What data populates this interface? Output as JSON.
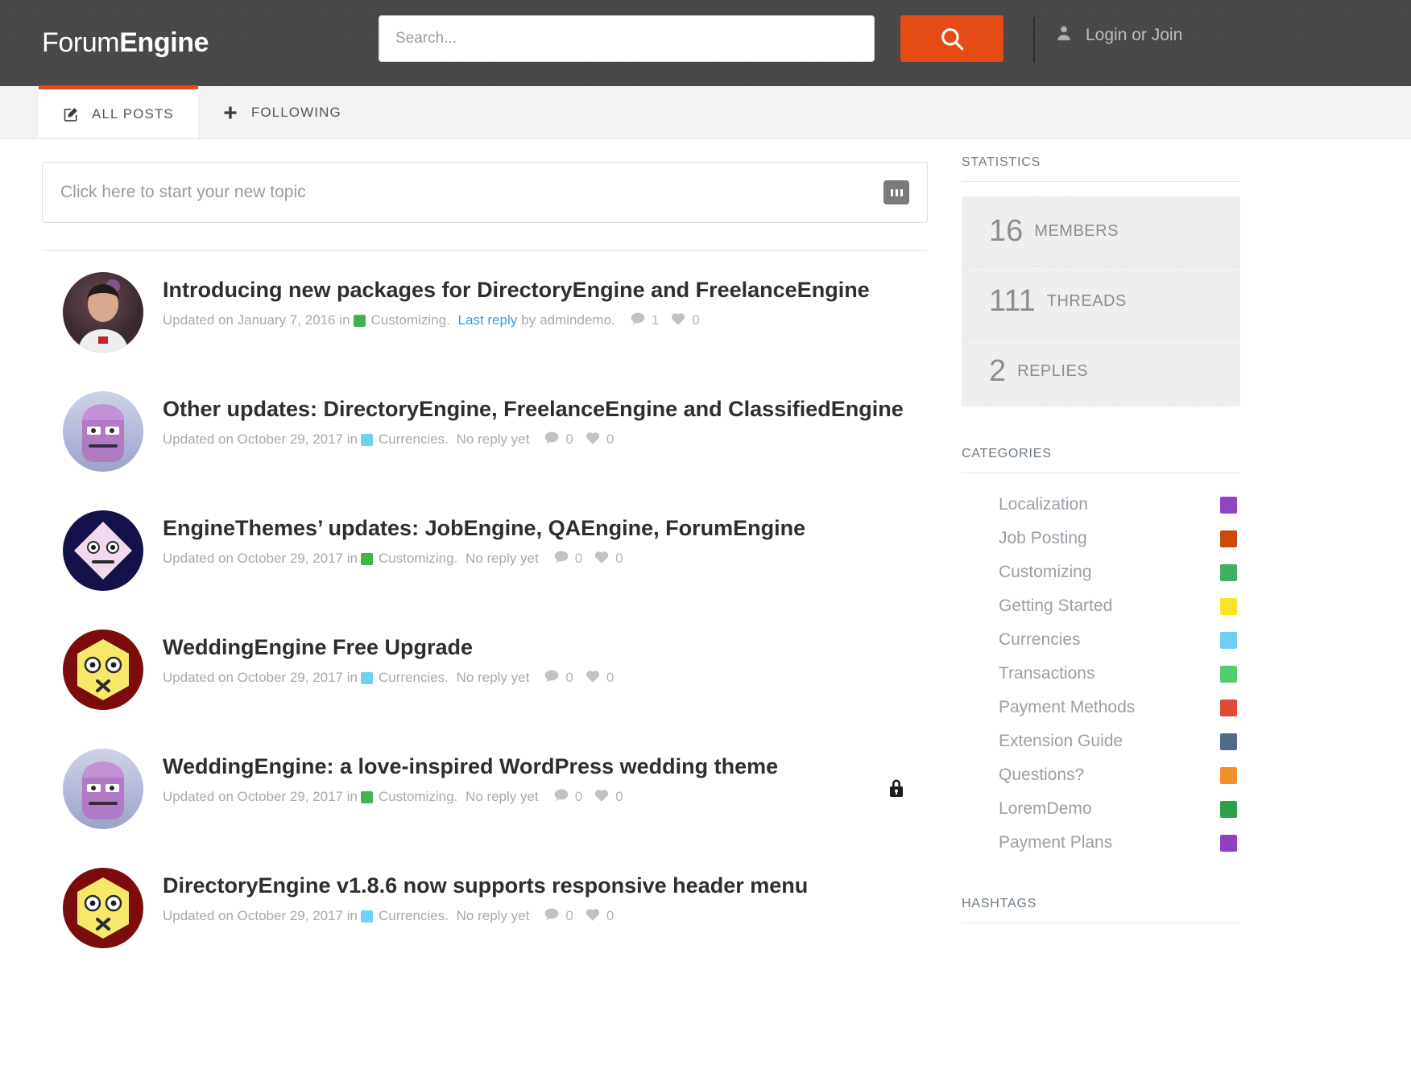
{
  "header": {
    "brand_light": "Forum",
    "brand_bold": "Engine",
    "search_placeholder": "Search...",
    "search_value": "",
    "search_icon": "search-icon",
    "user_icon": "user-icon",
    "login_label": "Login or Join"
  },
  "tabs": [
    {
      "label": "ALL POSTS",
      "icon": "compose-icon",
      "active": true
    },
    {
      "label": "FOLLOWING",
      "icon": "plus-icon",
      "active": false
    }
  ],
  "new_topic": {
    "placeholder": "Click here to start your new topic",
    "button_icon": "more-options-icon"
  },
  "posts": [
    {
      "title": "Introducing new packages for DirectoryEngine and FreelanceEngine",
      "updated_prefix": "Updated on",
      "date": "January 7, 2016",
      "in_word": "in",
      "category": "Customizing.",
      "category_color": "#3eb34f",
      "reply_link": "Last reply",
      "by_word": "by",
      "author": "admindemo.",
      "comments": "1",
      "likes": "0",
      "locked": false
    },
    {
      "title": "Other updates: DirectoryEngine, FreelanceEngine and ClassifiedEngine",
      "updated_prefix": "Updated on",
      "date": "October 29, 2017",
      "in_word": "in",
      "category": "Currencies.",
      "category_color": "#6ed0f5",
      "no_reply": "No reply yet",
      "comments": "0",
      "likes": "0",
      "locked": false
    },
    {
      "title": "EngineThemes’ updates: JobEngine, QAEngine, ForumEngine",
      "updated_prefix": "Updated on",
      "date": "October 29, 2017",
      "in_word": "in",
      "category": "Customizing.",
      "category_color": "#3eb34f",
      "no_reply": "No reply yet",
      "comments": "0",
      "likes": "0",
      "locked": false
    },
    {
      "title": "WeddingEngine Free Upgrade",
      "updated_prefix": "Updated on",
      "date": "October 29, 2017",
      "in_word": "in",
      "category": "Currencies.",
      "category_color": "#6ed0f5",
      "no_reply": "No reply yet",
      "comments": "0",
      "likes": "0",
      "locked": false
    },
    {
      "title": "WeddingEngine: a love-inspired WordPress wedding theme",
      "updated_prefix": "Updated on",
      "date": "October 29, 2017",
      "in_word": "in",
      "category": "Customizing.",
      "category_color": "#3eb34f",
      "no_reply": "No reply yet",
      "comments": "0",
      "likes": "0",
      "locked": true
    },
    {
      "title": "DirectoryEngine v1.8.6 now supports responsive header menu",
      "updated_prefix": "Updated on",
      "date": "October 29, 2017",
      "in_word": "in",
      "category": "Currencies.",
      "category_color": "#6ed0f5",
      "no_reply": "No reply yet",
      "comments": "0",
      "likes": "0",
      "locked": false
    }
  ],
  "sidebar": {
    "statistics_heading": "STATISTICS",
    "stats": [
      {
        "number": "16",
        "label": "MEMBERS"
      },
      {
        "number": "111",
        "label": "THREADS"
      },
      {
        "number": "2",
        "label": "REPLIES"
      }
    ],
    "categories_heading": "CATEGORIES",
    "categories": [
      {
        "name": "Localization",
        "color": "#8e44c4"
      },
      {
        "name": "Job Posting",
        "color": "#cc4a05"
      },
      {
        "name": "Customizing",
        "color": "#41af5f"
      },
      {
        "name": "Getting Started",
        "color": "#f9e526"
      },
      {
        "name": "Currencies",
        "color": "#6ecdf2"
      },
      {
        "name": "Transactions",
        "color": "#4fce6b"
      },
      {
        "name": "Payment Methods",
        "color": "#e04a38"
      },
      {
        "name": "Extension Guide",
        "color": "#516b8c"
      },
      {
        "name": "Questions?",
        "color": "#f0912d"
      },
      {
        "name": "LoremDemo",
        "color": "#2ea04a"
      },
      {
        "name": "Payment Plans",
        "color": "#9040c0"
      }
    ],
    "hashtags_heading": "HASHTAGS"
  },
  "colors": {
    "accent": "#e54b14",
    "header_bg": "#464646",
    "link": "#3f9ad8"
  }
}
